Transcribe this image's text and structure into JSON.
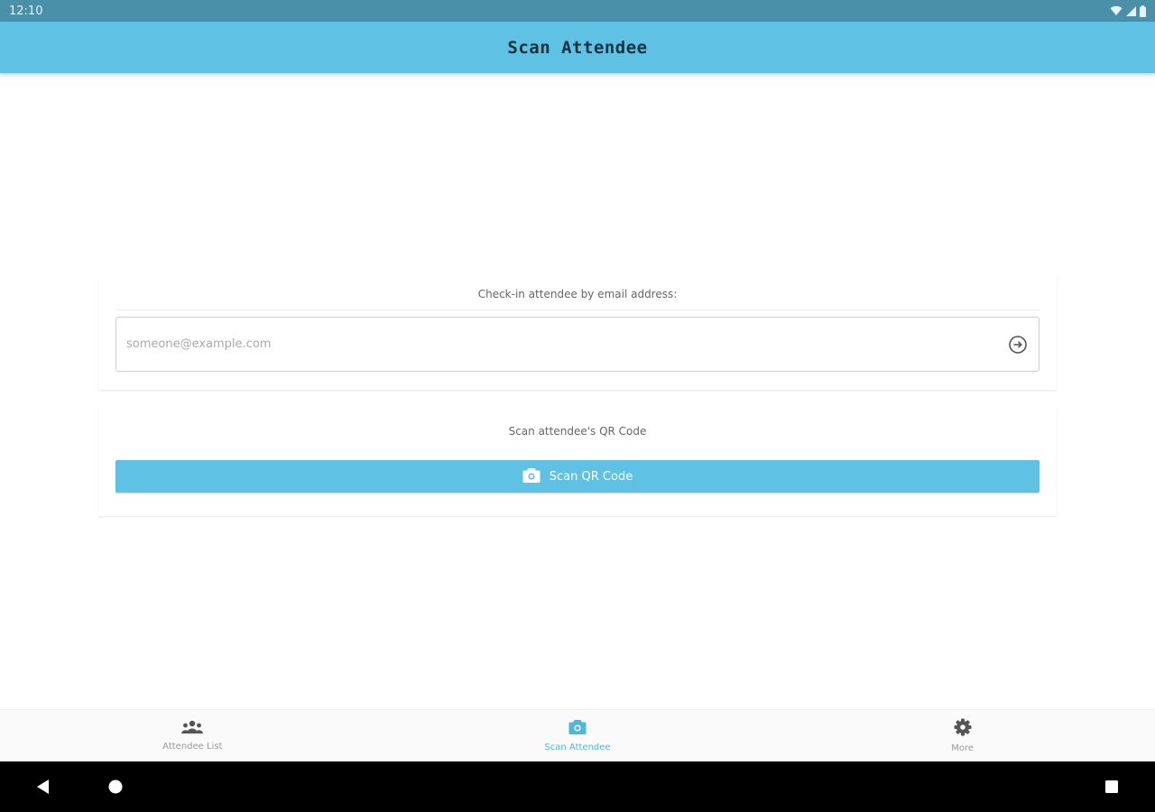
{
  "status_bar": {
    "time": "12:10",
    "icons": [
      "wifi-icon",
      "signal-icon",
      "battery-icon"
    ]
  },
  "app_bar": {
    "title": "Scan Attendee"
  },
  "email_checkin": {
    "label": "Check-in attendee by email address:",
    "input_value": "",
    "placeholder": "someone@example.com",
    "submit_icon": "arrow-circle-right-icon"
  },
  "qr_checkin": {
    "label": "Scan attendee's QR Code",
    "button_label": "Scan QR Code",
    "button_icon": "camera-icon"
  },
  "bottom_nav": {
    "items": [
      {
        "label": "Attendee List",
        "icon": "people-icon",
        "active": false
      },
      {
        "label": "Scan Attendee",
        "icon": "camera-icon",
        "active": true
      },
      {
        "label": "More",
        "icon": "gear-icon",
        "active": false
      }
    ]
  },
  "system_nav": {
    "icons": [
      "back-icon",
      "home-icon",
      "recents-icon"
    ]
  },
  "colors": {
    "primary": "#5fc1e3",
    "status_bar": "#4a90a9",
    "active_nav": "#4fb6dc",
    "title_text": "#16323c"
  }
}
